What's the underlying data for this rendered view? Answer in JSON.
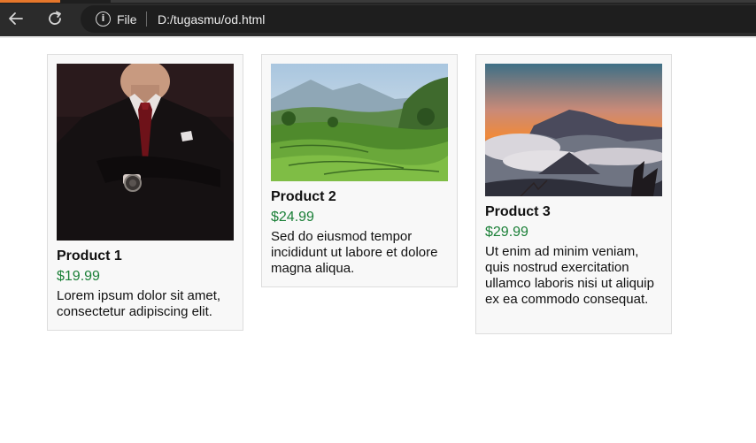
{
  "browser": {
    "scheme_label": "File",
    "url": "D:/tugasmu/od.html",
    "icons": {
      "back": "back-arrow-icon",
      "reload": "reload-icon",
      "info": "info-icon"
    }
  },
  "products": [
    {
      "title": "Product 1",
      "price": "$19.99",
      "description": "Lorem ipsum dolor sit amet, consectetur adipiscing elit.",
      "image": "man-in-suit-photo"
    },
    {
      "title": "Product 2",
      "price": "$24.99",
      "description": "Sed do eiusmod tempor incididunt ut labore et dolore magna aliqua.",
      "image": "rice-terrace-photo"
    },
    {
      "title": "Product 3",
      "price": "$29.99",
      "description": "Ut enim ad minim veniam, quis nostrud exercitation ullamco laboris nisi ut aliquip ex ea commodo consequat.",
      "image": "volcano-sunrise-photo"
    }
  ],
  "colors": {
    "price": "#1a7f37",
    "card_bg": "#f8f8f8",
    "chrome_bg": "#2b2b2b"
  }
}
